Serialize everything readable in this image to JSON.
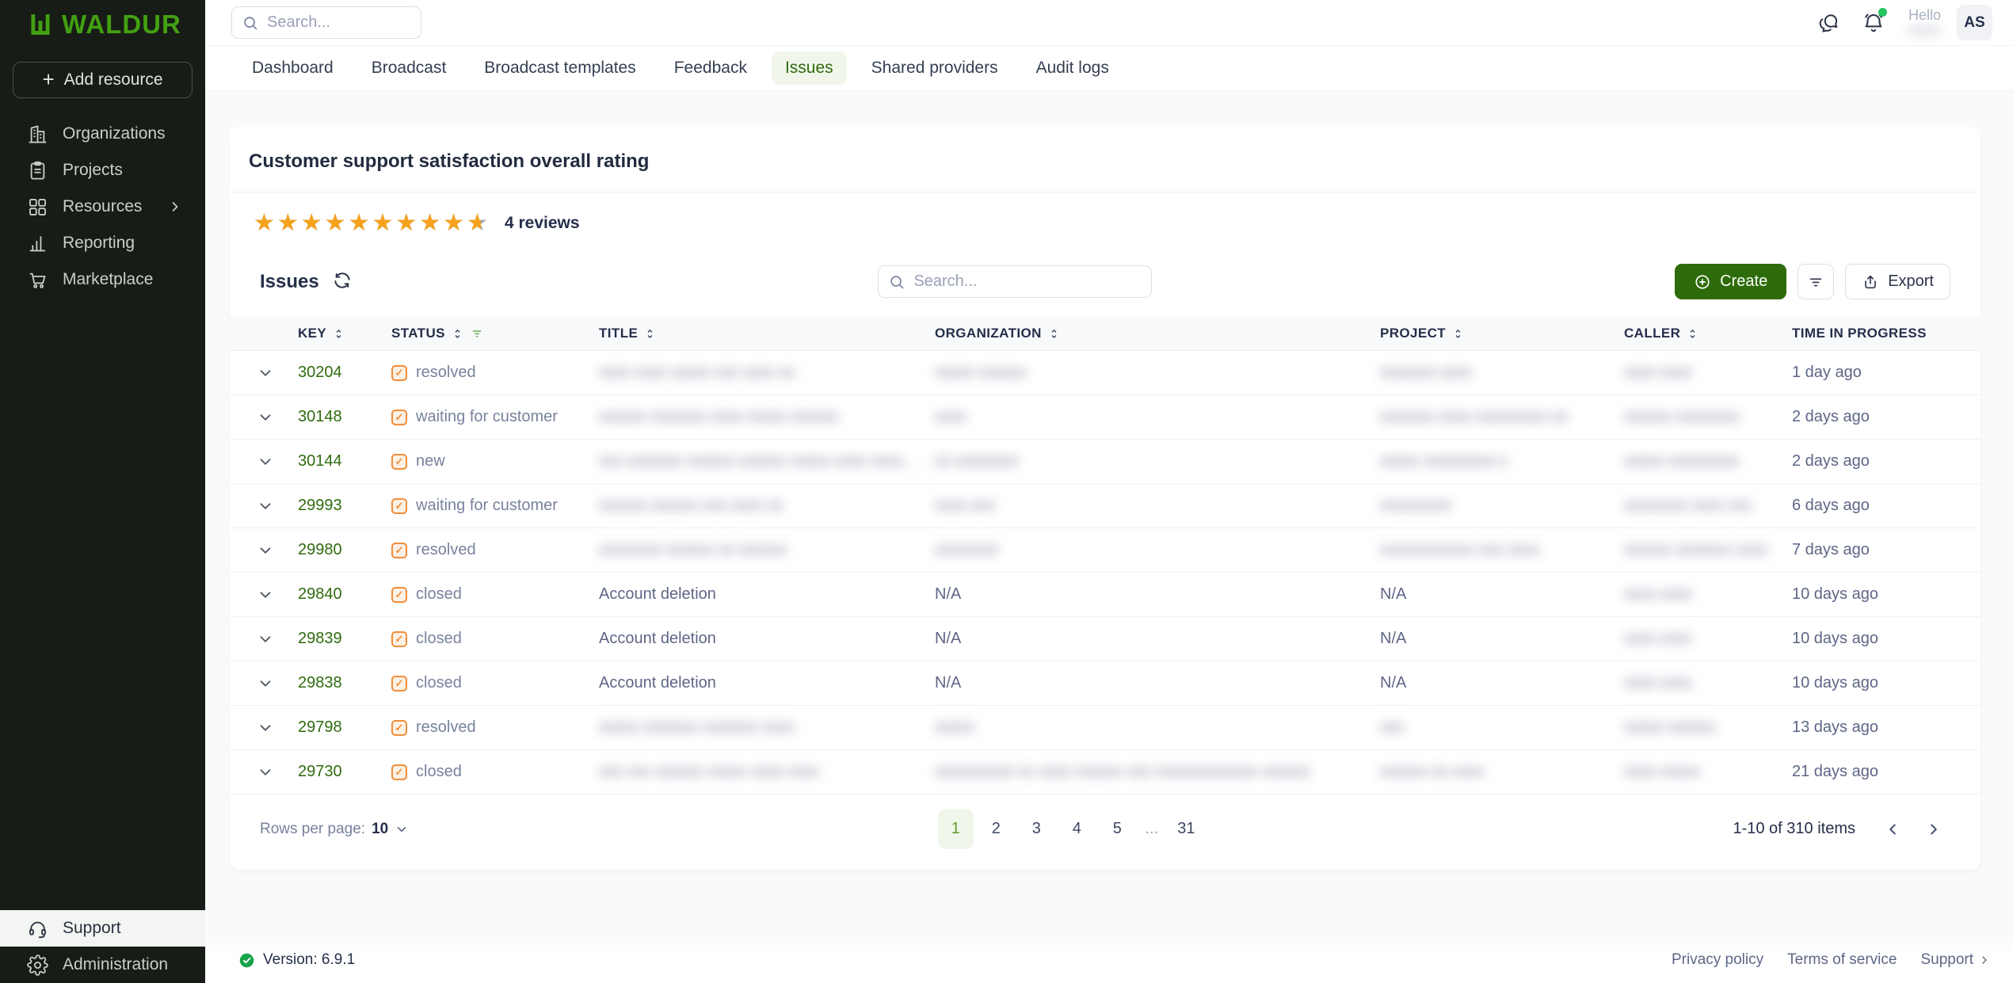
{
  "colors": {
    "brand_green": "#43a012",
    "accent_green_dark": "#2f6b0e",
    "create_button_green": "#2e6c0b",
    "star_orange": "#f6a21e",
    "status_badge_orange": "#ef8e3a",
    "notification_dot_green": "#22c55e",
    "sidebar_bg": "#171d16",
    "navy_text": "#252f4a"
  },
  "sidebar": {
    "logo_text": "WALDUR",
    "add_resource_label": "Add resource",
    "items": [
      {
        "label": "Organizations",
        "icon": "buildings"
      },
      {
        "label": "Projects",
        "icon": "clipboard"
      },
      {
        "label": "Resources",
        "icon": "grid",
        "chevron": true
      },
      {
        "label": "Reporting",
        "icon": "bar-chart"
      },
      {
        "label": "Marketplace",
        "icon": "cart"
      }
    ],
    "bottom_items": [
      {
        "label": "Support",
        "icon": "headset",
        "active": true
      },
      {
        "label": "Administration",
        "icon": "gear"
      }
    ]
  },
  "topbar": {
    "search_placeholder": "Search...",
    "greeting": "Hello",
    "user_name_redacted": "xxxxx",
    "avatar_initials": "AS"
  },
  "tabs": [
    {
      "label": "Dashboard"
    },
    {
      "label": "Broadcast"
    },
    {
      "label": "Broadcast templates"
    },
    {
      "label": "Feedback"
    },
    {
      "label": "Issues",
      "active": true
    },
    {
      "label": "Shared providers"
    },
    {
      "label": "Audit logs"
    }
  ],
  "rating": {
    "title": "Customer support satisfaction overall rating",
    "stars_total": 10,
    "stars_filled": 9.6,
    "reviews_label": "4 reviews"
  },
  "issues": {
    "title": "Issues",
    "search_placeholder": "Search...",
    "create_label": "Create",
    "export_label": "Export",
    "columns": [
      {
        "label": "KEY",
        "sortable": true
      },
      {
        "label": "STATUS",
        "sortable": true,
        "filtered": true
      },
      {
        "label": "TITLE",
        "sortable": true
      },
      {
        "label": "ORGANIZATION",
        "sortable": true
      },
      {
        "label": "PROJECT",
        "sortable": true
      },
      {
        "label": "CALLER",
        "sortable": true
      },
      {
        "label": "TIME IN PROGRESS",
        "sortable": false
      }
    ],
    "rows": [
      {
        "key": "30204",
        "status": "resolved",
        "title": {
          "text": "xxxx xxxx xxxxx xxx xxxx xx",
          "blur": true
        },
        "organization": {
          "text": "xxxxx xxxxxx",
          "blur": true
        },
        "project": {
          "text": "xxxxxxx xxxx",
          "blur": true
        },
        "caller": {
          "text": "xxxx xxxx",
          "blur": true
        },
        "time": "1 day ago"
      },
      {
        "key": "30148",
        "status": "waiting for customer",
        "title": {
          "text": "xxxxxx xxxxxxx xxxx xxxxx xxxxxx",
          "blur": true
        },
        "organization": {
          "text": "xxxx",
          "blur": true
        },
        "project": {
          "text": "xxxxxxx xxxx xxxxxxxxx xx",
          "blur": true
        },
        "caller": {
          "text": "xxxxxx xxxxxxxx",
          "blur": true
        },
        "time": "2 days ago"
      },
      {
        "key": "30144",
        "status": "new",
        "title": {
          "text": "xxx xxxxxxx xxxxxx xxxxxx xxxxx xxxx xxxxx xx",
          "blur": true
        },
        "organization": {
          "text": "xx xxxxxxxx",
          "blur": true
        },
        "project": {
          "text": "xxxxx xxxxxxxxx x",
          "blur": true
        },
        "caller": {
          "text": "xxxxx xxxxxxxxx",
          "blur": true
        },
        "time": "2 days ago"
      },
      {
        "key": "29993",
        "status": "waiting for customer",
        "title": {
          "text": "xxxxxx xxxxxx xxx xxxx xx",
          "blur": true
        },
        "organization": {
          "text": "xxxx xxx",
          "blur": true
        },
        "project": {
          "text": "xxxxxxxxx",
          "blur": true
        },
        "caller": {
          "text": "xxxxxxxx xxxx xxx",
          "blur": true
        },
        "time": "6 days ago"
      },
      {
        "key": "29980",
        "status": "resolved",
        "title": {
          "text": "xxxxxxxx xxxxxx xx xxxxxx",
          "blur": true
        },
        "organization": {
          "text": "xxxxxxxx",
          "blur": true
        },
        "project": {
          "text": "xxxxxxxxxxxx xxx xxxx",
          "blur": true
        },
        "caller": {
          "text": "xxxxxx xxxxxxx xxxx",
          "blur": true
        },
        "time": "7 days ago"
      },
      {
        "key": "29840",
        "status": "closed",
        "title": {
          "text": "Account deletion",
          "blur": false
        },
        "organization": {
          "text": "N/A",
          "blur": false
        },
        "project": {
          "text": "N/A",
          "blur": false
        },
        "caller": {
          "text": "xxxx xxxx",
          "blur": true
        },
        "time": "10 days ago"
      },
      {
        "key": "29839",
        "status": "closed",
        "title": {
          "text": "Account deletion",
          "blur": false
        },
        "organization": {
          "text": "N/A",
          "blur": false
        },
        "project": {
          "text": "N/A",
          "blur": false
        },
        "caller": {
          "text": "xxxx xxxx",
          "blur": true
        },
        "time": "10 days ago"
      },
      {
        "key": "29838",
        "status": "closed",
        "title": {
          "text": "Account deletion",
          "blur": false
        },
        "organization": {
          "text": "N/A",
          "blur": false
        },
        "project": {
          "text": "N/A",
          "blur": false
        },
        "caller": {
          "text": "xxxx xxxx",
          "blur": true
        },
        "time": "10 days ago"
      },
      {
        "key": "29798",
        "status": "resolved",
        "title": {
          "text": "xxxxx xxxxxxx xxxxxxx xxxx",
          "blur": true
        },
        "organization": {
          "text": "xxxxx",
          "blur": true
        },
        "project": {
          "text": "xxx",
          "blur": true
        },
        "caller": {
          "text": "xxxxx xxxxxx",
          "blur": true
        },
        "time": "13 days ago"
      },
      {
        "key": "29730",
        "status": "closed",
        "title": {
          "text": "xxx xxx xxxxxx xxxxx xxxx xxxx",
          "blur": true
        },
        "organization": {
          "text": "xxxxxxxxxx xx xxxx xxxxxx xxx xxxxxxxxxxxxx xxxxxx",
          "blur": true
        },
        "project": {
          "text": "xxxxxx xx xxxx",
          "blur": true
        },
        "caller": {
          "text": "xxxx xxxxx",
          "blur": true
        },
        "time": "21 days ago"
      }
    ],
    "pagination": {
      "rows_per_page_label": "Rows per page:",
      "rows_per_page_value": "10",
      "pages": [
        {
          "label": "1",
          "active": true
        },
        {
          "label": "2"
        },
        {
          "label": "3"
        },
        {
          "label": "4"
        },
        {
          "label": "5"
        },
        {
          "label": "...",
          "ellipsis": true
        },
        {
          "label": "31"
        }
      ],
      "range_label": "1-10 of 310 items"
    }
  },
  "footer": {
    "version": "Version: 6.9.1",
    "links": [
      {
        "label": "Privacy policy"
      },
      {
        "label": "Terms of service"
      },
      {
        "label": "Support",
        "chevron": true
      }
    ]
  }
}
